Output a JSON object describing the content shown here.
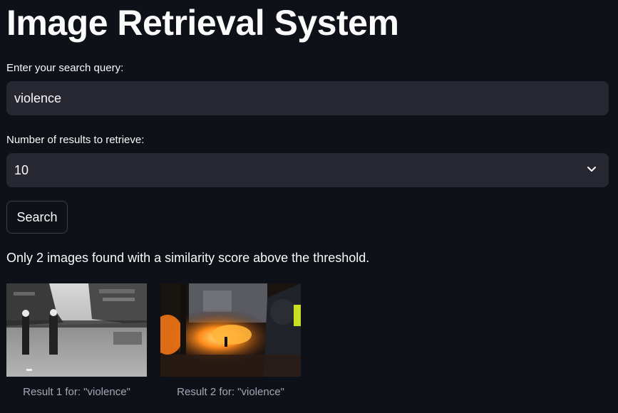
{
  "page": {
    "title": "Image Retrieval System"
  },
  "search": {
    "label": "Enter your search query:",
    "value": "violence"
  },
  "count": {
    "label": "Number of results to retrieve:",
    "selected": "10"
  },
  "actions": {
    "search_label": "Search"
  },
  "status": {
    "message": "Only 2 images found with a similarity score above the threshold."
  },
  "results": [
    {
      "caption": "Result 1 for: \"violence\""
    },
    {
      "caption": "Result 2 for: \"violence\""
    }
  ]
}
